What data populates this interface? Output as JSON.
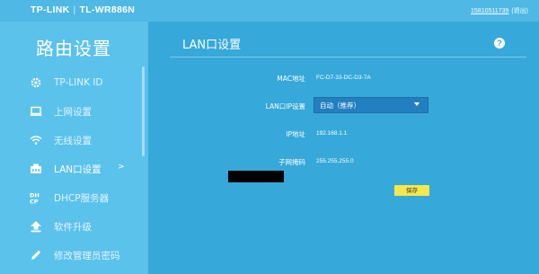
{
  "header": {
    "brand": "TP-LINK",
    "separator": "|",
    "model": "TL-WR886N",
    "account": "15810511739",
    "logout": "(退出)"
  },
  "sidebar": {
    "title": "路由设置",
    "items": [
      {
        "label": "TP-LINK ID",
        "icon": "gear-icon"
      },
      {
        "label": "上网设置",
        "icon": "laptop-icon"
      },
      {
        "label": "无线设置",
        "icon": "wifi-icon"
      },
      {
        "label": "LAN口设置",
        "icon": "lan-icon",
        "active": true,
        "chevron": ">"
      },
      {
        "label": "DHCP服务器",
        "icon": "dhcp-icon"
      },
      {
        "label": "软件升级",
        "icon": "upload-icon"
      },
      {
        "label": "修改管理员密码",
        "icon": "pencil-icon"
      }
    ]
  },
  "main": {
    "title": "LAN口设置",
    "help": "?",
    "fields": {
      "mac_label": "MAC地址",
      "mac_value": "FC-D7-33-DC-D3-7A",
      "lan_ip_label": "LAN口IP设置",
      "lan_ip_value": "自动（推荐）",
      "ip_label": "IP地址",
      "ip_value": "192.168.1.1",
      "mask_label": "子网掩码",
      "mask_value": "255.255.255.0"
    },
    "save_label": "保存"
  },
  "colors": {
    "page_bg": "#4fb8e4",
    "sidebar_bg": "#5bc2ec",
    "main_bg": "#36a8d9",
    "select_bg": "#237fbf",
    "save_bg": "#f6e84a"
  }
}
